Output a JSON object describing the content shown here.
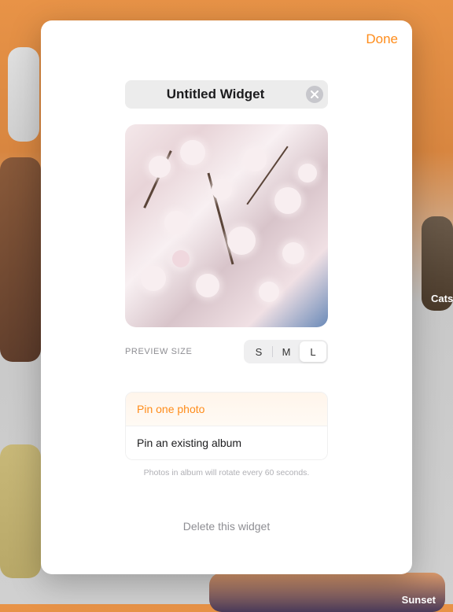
{
  "background_tiles": {
    "cats_label": "Cats",
    "sunset_label": "Sunset"
  },
  "modal": {
    "done_label": "Done",
    "title": "Untitled Widget",
    "preview_size_label": "PREVIEW SIZE",
    "sizes": [
      "S",
      "M",
      "L"
    ],
    "active_size": "L",
    "options": {
      "pin_photo": "Pin one photo",
      "pin_album": "Pin an existing album"
    },
    "selected_option": "pin_photo",
    "rotation_hint": "Photos in album will rotate every 60 seconds.",
    "delete_label": "Delete this widget"
  }
}
